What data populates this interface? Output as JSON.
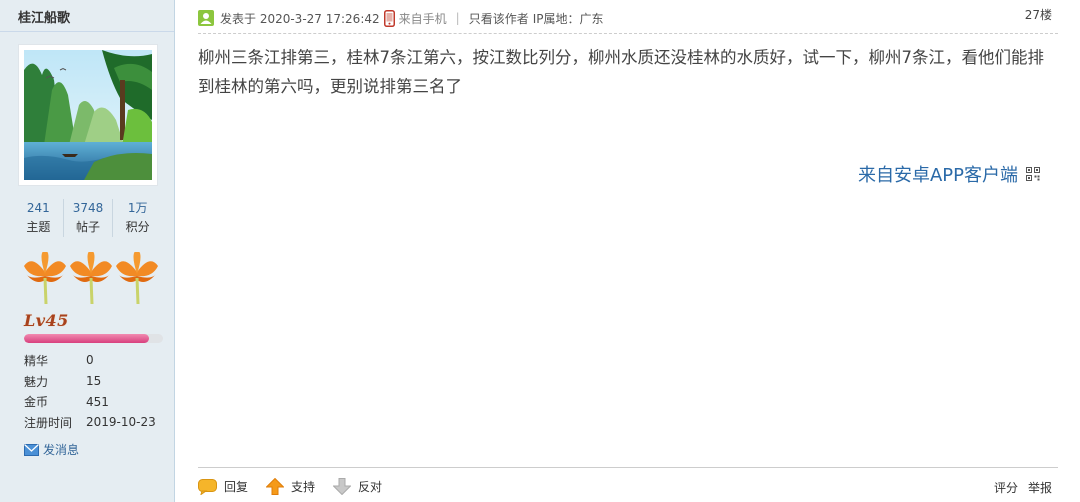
{
  "author": {
    "username": "桂江船歌",
    "stats": [
      {
        "value": "241",
        "label": "主题"
      },
      {
        "value": "3748",
        "label": "帖子"
      },
      {
        "value": "1万",
        "label": "积分"
      }
    ],
    "level": "Lv45",
    "level_progress": 0.9,
    "info": [
      {
        "label": "精华",
        "value": "0"
      },
      {
        "label": "魅力",
        "value": "15"
      },
      {
        "label": "金币",
        "value": "451"
      },
      {
        "label": "注册时间",
        "value": "2019-10-23"
      }
    ],
    "send_message": "发消息"
  },
  "post": {
    "posted_at": "发表于 2020-3-27 17:26:42",
    "from_mobile": "来自手机",
    "only_author": "只看该作者",
    "ip_location": "IP属地：广东",
    "floor": "27楼",
    "body": "柳州三条江排第三，桂林7条江第六，按江数比列分，柳州水质还没桂林的水质好，试一下，柳州7条江，看他们能排到桂林的第六吗，更别说排第三名了",
    "app_source": "来自安卓APP客户端"
  },
  "actions": {
    "reply": "回复",
    "support": "支持",
    "oppose": "反对",
    "rate": "评分",
    "report": "举报"
  },
  "colors": {
    "sidebar_bg": "#e5edf2",
    "link": "#336699",
    "app_link": "#2b6aa8",
    "level_bar": "#d8407e"
  }
}
